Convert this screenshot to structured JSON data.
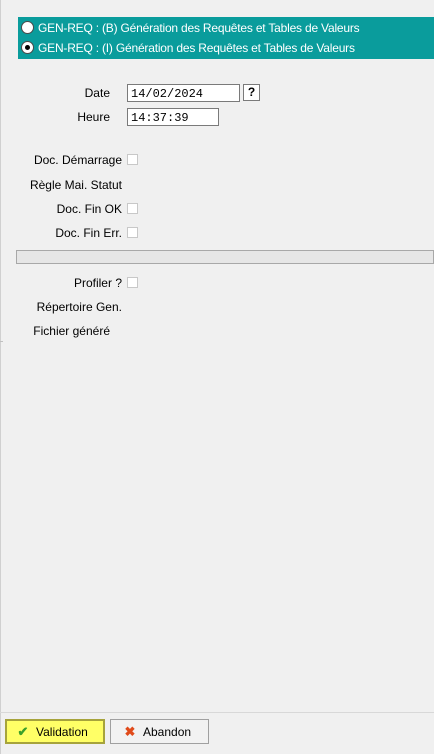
{
  "mode_options": [
    {
      "label": "GEN-REQ : (B) Génération des Requêtes et Tables de Valeurs",
      "selected": false
    },
    {
      "label": "GEN-REQ : (I) Génération des Requêtes et Tables de Valeurs",
      "selected": true
    }
  ],
  "form": {
    "date_label": "Date",
    "date_value": "14/02/2024",
    "help_label": "?",
    "time_label": "Heure",
    "time_value": "14:37:39",
    "doc_start_label": "Doc. Démarrage",
    "rule_status_label": "Règle Mai. Statut",
    "doc_end_ok_label": "Doc. Fin OK",
    "doc_end_err_label": "Doc. Fin Err.",
    "profiler_label": "Profiler ?",
    "directory_label": "Répertoire Gen.",
    "generated_file_label": "Fichier généré"
  },
  "buttons": {
    "validate_label": "Validation",
    "cancel_label": "Abandon"
  },
  "colors": {
    "mode_panel_bg": "#0a9c9c",
    "validate_bg": "#ffff66"
  }
}
